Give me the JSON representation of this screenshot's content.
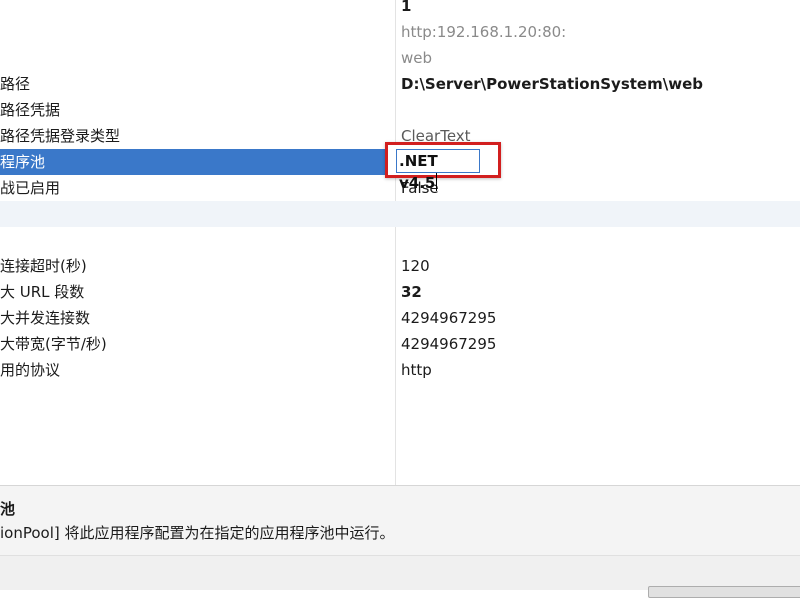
{
  "properties": [
    {
      "name": "",
      "value": "1",
      "style": "bold"
    },
    {
      "name": "",
      "value": "http:192.168.1.20:80:",
      "style": "gray"
    },
    {
      "name": "",
      "value": "web",
      "style": "gray"
    },
    {
      "name": "路径",
      "value": "D:\\Server\\PowerStationSystem\\web",
      "style": "bold"
    },
    {
      "name": "路径凭据",
      "value": "",
      "style": ""
    },
    {
      "name": "路径凭据登录类型",
      "value": "ClearText",
      "style": "clip"
    },
    {
      "name": "程序池",
      "value": "",
      "style": "",
      "selected": true
    },
    {
      "name": "战已启用",
      "value": "False",
      "style": ""
    },
    {
      "name": "",
      "value": "",
      "style": "section"
    },
    {
      "name": "",
      "value": "",
      "style": ""
    },
    {
      "name": "连接超时(秒)",
      "value": "120",
      "style": ""
    },
    {
      "name": "大 URL 段数",
      "value": "32",
      "style": "bold"
    },
    {
      "name": "大并发连接数",
      "value": "4294967295",
      "style": ""
    },
    {
      "name": "大带宽(字节/秒)",
      "value": "4294967295",
      "style": ""
    },
    {
      "name": "用的协议",
      "value": "http",
      "style": ""
    }
  ],
  "editor": {
    "value": ".NET v4.5"
  },
  "description": {
    "title": "池",
    "text": "ionPool] 将此应用程序配置为在指定的应用程序池中运行。"
  },
  "colors": {
    "selection": "#3a78c9",
    "highlight_border": "#d21f1f"
  }
}
